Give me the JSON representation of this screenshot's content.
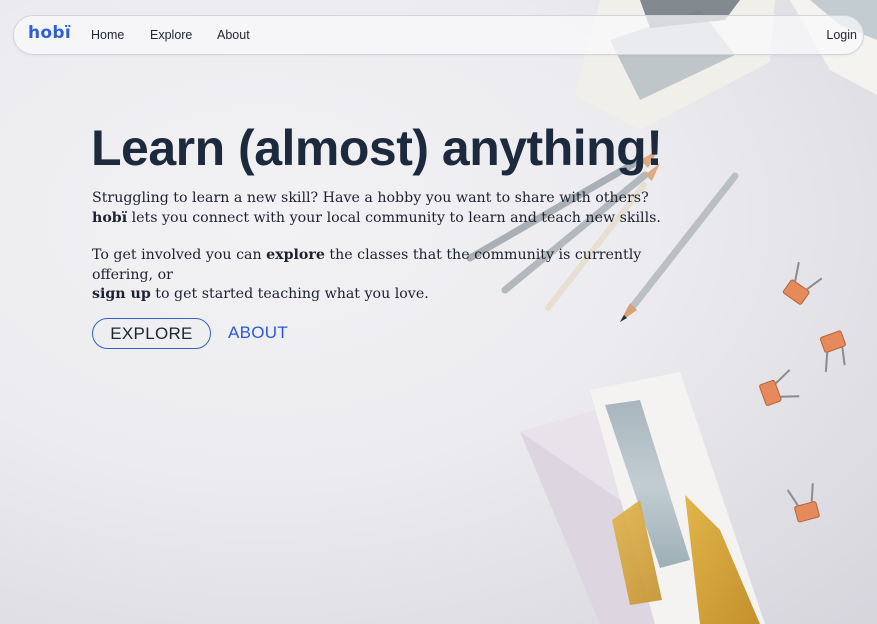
{
  "nav": {
    "logo": "hobï",
    "links": [
      "Home",
      "Explore",
      "About"
    ],
    "login": "Login"
  },
  "hero": {
    "title": "Learn (almost) anything!",
    "para1": {
      "before": "Struggling to learn a new skill? Have a hobby you want to share with others? ",
      "brand": "hobï",
      "after": " lets you connect with your local community to learn and teach new skills."
    },
    "para2": {
      "lead": "To get involved you can ",
      "explore": "explore",
      "middle": " the classes that the community is currently offering, or ",
      "signup": "sign up",
      "tail": " to get started teaching what you love."
    },
    "explore_button": "EXPLORE",
    "about_button": "ABOUT"
  },
  "colors": {
    "accent": "#2f5fd6",
    "heading": "#1d2a3e",
    "text": "#1d2230"
  }
}
